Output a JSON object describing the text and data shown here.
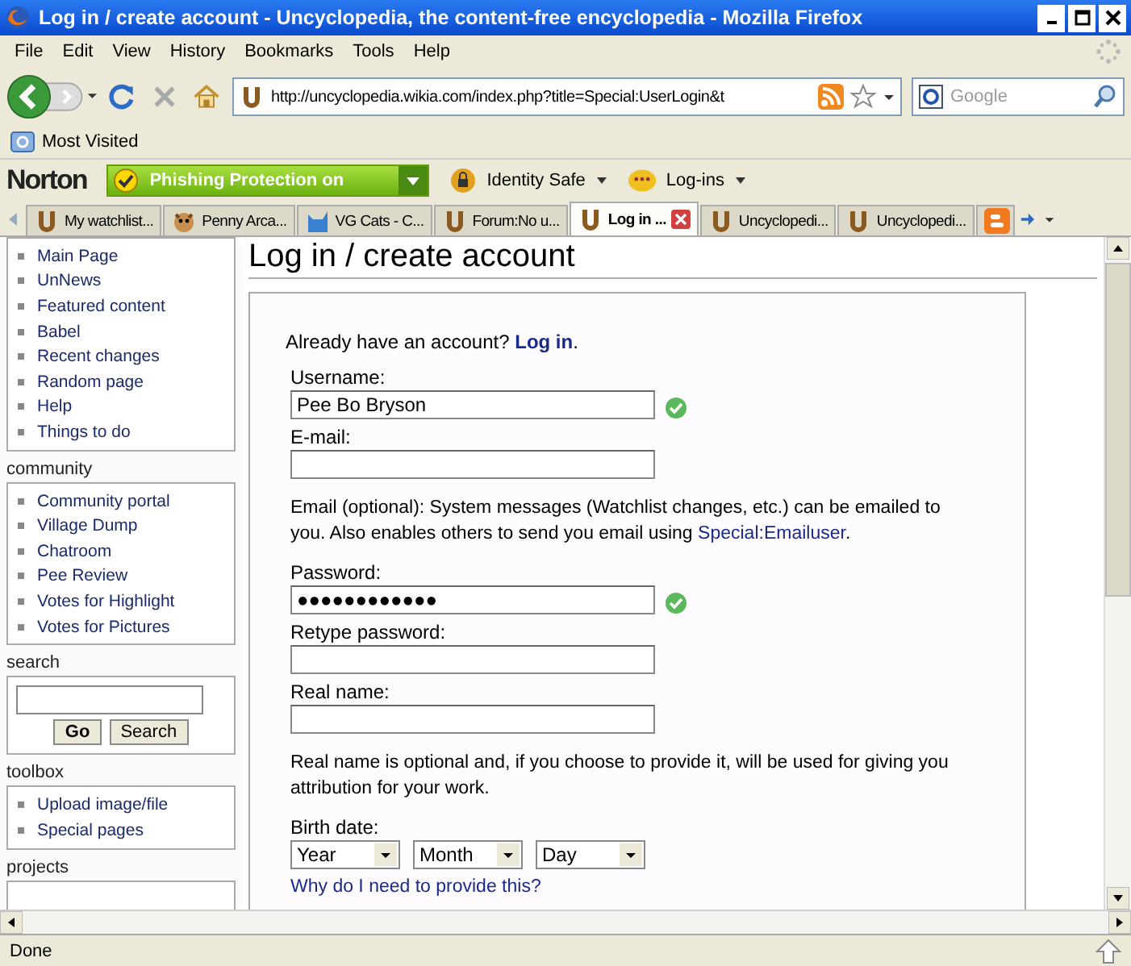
{
  "window": {
    "title": "Log in / create account - Uncyclopedia, the content-free encyclopedia - Mozilla Firefox"
  },
  "menu": [
    "File",
    "Edit",
    "View",
    "History",
    "Bookmarks",
    "Tools",
    "Help"
  ],
  "address_bar": {
    "value": "http://uncyclopedia.wikia.com/index.php?title=Special:UserLogin&t"
  },
  "search_bar": {
    "placeholder": "Google"
  },
  "bookmarks": [
    "Most Visited"
  ],
  "norton": {
    "logo": "Norton",
    "phishing": "Phishing Protection on",
    "identity": "Identity Safe",
    "logins": "Log-ins"
  },
  "tabs": [
    {
      "label": "My watchlist...",
      "kind": "wiki",
      "selected": false
    },
    {
      "label": "Penny Arca...",
      "kind": "comic",
      "selected": false
    },
    {
      "label": "VG Cats - C...",
      "kind": "cat",
      "selected": false
    },
    {
      "label": "Forum:No u...",
      "kind": "wiki",
      "selected": false
    },
    {
      "label": "Log in ...",
      "kind": "wiki",
      "selected": true
    },
    {
      "label": "Uncyclopedi...",
      "kind": "wiki",
      "selected": false
    },
    {
      "label": "Uncyclopedi...",
      "kind": "wiki",
      "selected": false
    },
    {
      "kind": "blog",
      "selected": false
    }
  ],
  "sidebar": [
    {
      "items": [
        "Main Page",
        "UnNews",
        "Featured content",
        "Babel",
        "Recent changes",
        "Random page",
        "Help",
        "Things to do"
      ]
    },
    {
      "title": "community",
      "items": [
        "Community portal",
        "Village Dump",
        "Chatroom",
        "Pee Review",
        "Votes for Highlight",
        "Votes for Pictures"
      ]
    },
    {
      "title": "search",
      "kind": "search",
      "buttons": [
        "Go",
        "Search"
      ]
    },
    {
      "title": "toolbox",
      "items": [
        "Upload image/file",
        "Special pages"
      ]
    },
    {
      "title": "projects",
      "kind": "cut"
    }
  ],
  "page": {
    "heading": "Log in / create account",
    "form": [
      {
        "kind": "intro",
        "text": "Already have an account?",
        "link": "Log in",
        "after": "."
      },
      {
        "kind": "field",
        "label": "Username:",
        "value": "Pee Bo Bryson",
        "valid": true
      },
      {
        "kind": "field",
        "label": "E-mail:"
      },
      {
        "kind": "note",
        "text": "Email (optional): System messages (Watchlist changes, etc.) can be emailed to you. Also enables others to send you email using",
        "link": "Special:Emailuser",
        "after": "."
      },
      {
        "kind": "field",
        "label": "Password:",
        "value": "●●●●●●●●●●●●",
        "valid": true
      },
      {
        "kind": "field",
        "label": "Retype password:"
      },
      {
        "kind": "field",
        "label": "Real name:"
      },
      {
        "kind": "note",
        "text": "Real name is optional and, if you choose to provide it, will be used for giving you attribution for your work."
      },
      {
        "kind": "date",
        "label": "Birth date:",
        "selects": [
          "Year",
          "Month",
          "Day"
        ]
      },
      {
        "kind": "link",
        "link": "Why do I need to provide this?"
      }
    ]
  },
  "status_bar": "Done"
}
